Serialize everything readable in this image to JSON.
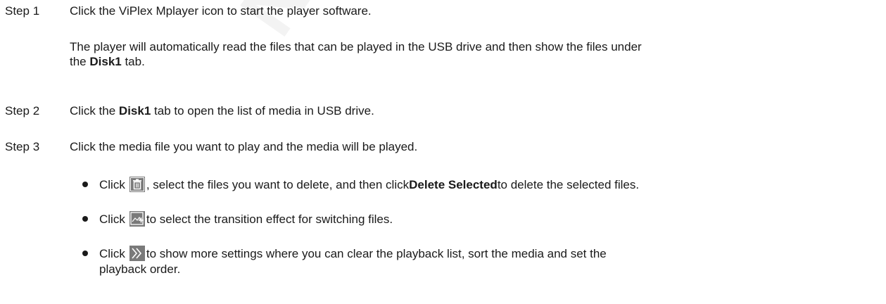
{
  "watermark": "NOVASTAR",
  "step1": {
    "label": "Step 1",
    "text": "Click the ViPlex Mplayer icon to start the player software.",
    "note_line1": "The player will automatically read the files that can be played in the USB drive and then show the files under",
    "note_line2_pre": "the ",
    "note_line2_bold": "Disk1",
    "note_line2_post": " tab."
  },
  "step2": {
    "label": "Step 2",
    "pre": "Click the ",
    "bold": "Disk1",
    "post": " tab to open the list of media in USB drive."
  },
  "step3": {
    "label": "Step 3",
    "text": "Click the media file you want to play and the media will be played."
  },
  "bullets": [
    {
      "icon": "trash-icon",
      "click": "Click",
      "pre": ", select the files you want to delete, and then click ",
      "bold": "Delete Selected",
      "post": " to delete the selected files."
    },
    {
      "icon": "transition-effect-icon",
      "click": "Click",
      "text": " to select the transition effect for switching files."
    },
    {
      "icon": "double-chevron-right-icon",
      "click": "Click",
      "text_line1": " to show more settings where you can clear the playback list, sort the media and set the",
      "text_line2": "playback order."
    }
  ],
  "colors": {
    "text": "#1a1a1a",
    "icon_bg": "#7a7a7a",
    "icon_fg": "#ffffff"
  }
}
